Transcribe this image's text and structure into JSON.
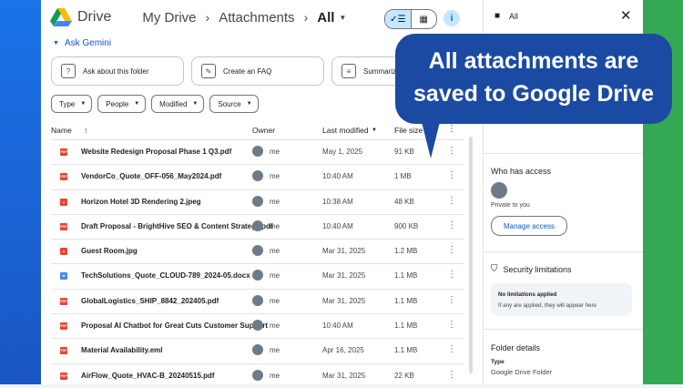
{
  "app": {
    "name": "Drive"
  },
  "breadcrumb": {
    "items": [
      "My Drive",
      "Attachments",
      "All"
    ]
  },
  "gemini": {
    "label": "Ask Gemini"
  },
  "suggestions": [
    {
      "label": "Ask about this folder",
      "icon": "doc-chat-icon"
    },
    {
      "label": "Create an FAQ",
      "icon": "pen-sparkle-icon"
    },
    {
      "label": "Summarize",
      "icon": "summary-icon"
    }
  ],
  "filters": [
    {
      "label": "Type"
    },
    {
      "label": "People"
    },
    {
      "label": "Modified"
    },
    {
      "label": "Source"
    }
  ],
  "table": {
    "headers": {
      "name": "Name",
      "owner": "Owner",
      "modified": "Last modified",
      "size": "File size"
    },
    "rows": [
      {
        "name": "Website Redesign Proposal Phase 1 Q3.pdf",
        "type": "pdf",
        "owner": "me",
        "modified": "May 1, 2025",
        "size": "91 KB"
      },
      {
        "name": "VendorCo_Quote_OFF-056_May2024.pdf",
        "type": "pdf",
        "owner": "me",
        "modified": "10:40 AM",
        "size": "1 MB"
      },
      {
        "name": "Horizon Hotel 3D Rendering 2.jpeg",
        "type": "image",
        "owner": "me",
        "modified": "10:38 AM",
        "size": "48 KB"
      },
      {
        "name": "Draft Proposal - BrightHive SEO & Content Strategy.pdf",
        "type": "pdf",
        "owner": "me",
        "modified": "10:40 AM",
        "size": "900 KB"
      },
      {
        "name": "Guest Room.jpg",
        "type": "image",
        "owner": "me",
        "modified": "Mar 31, 2025",
        "size": "1.2 MB"
      },
      {
        "name": "TechSolutions_Quote_CLOUD-789_2024-05.docx",
        "type": "doc",
        "owner": "me",
        "modified": "Mar 31, 2025",
        "size": "1.1 MB"
      },
      {
        "name": "GlobalLogistics_SHIP_8842_202405.pdf",
        "type": "pdf",
        "owner": "me",
        "modified": "Mar 31, 2025",
        "size": "1.1 MB"
      },
      {
        "name": "Proposal AI Chatbot for Great Cuts Customer Support",
        "type": "pdf",
        "owner": "me",
        "modified": "10:40 AM",
        "size": "1.1 MB"
      },
      {
        "name": "Material Availability.eml",
        "type": "pdf",
        "owner": "me",
        "modified": "Apr 16, 2025",
        "size": "1.1 MB"
      },
      {
        "name": "AirFlow_Quote_HVAC-B_20240515.pdf",
        "type": "pdf",
        "owner": "me",
        "modified": "Mar 31, 2025",
        "size": "22 KB"
      }
    ]
  },
  "panel": {
    "title": "All",
    "who_has_access": "Who has access",
    "private_text": "Private to you",
    "manage_access": "Manage access",
    "security_title": "Security limitations",
    "security_l1": "No limitations applied",
    "security_l2": "If any are applied, they will appear here",
    "folder_details": "Folder details",
    "type_label": "Type",
    "type_value": "Google Drive Folder"
  },
  "callout": {
    "line1": "All attachments are",
    "line2": "saved to Google Drive"
  },
  "colors": {
    "pdf": "#ea4335",
    "image": "#ea4335",
    "doc": "#4285f4",
    "callout": "#1b4aa3",
    "accent": "#0b57d0"
  }
}
